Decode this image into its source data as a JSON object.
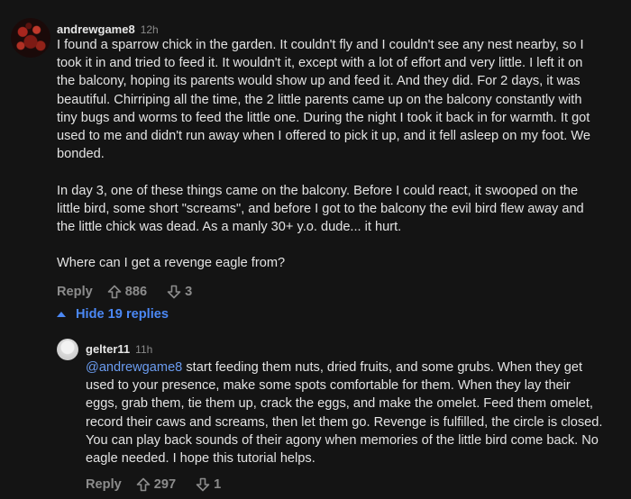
{
  "main_comment": {
    "username": "andrewgame8",
    "timestamp": "12h",
    "paragraphs": [
      "I found a sparrow chick in the garden. It couldn't fly and I couldn't see any nest nearby, so I took it in and tried to feed it. It wouldn't it, except with a lot of effort and very little. I left it on the balcony, hoping its parents would show up and feed it. And they did. For 2 days, it was beautiful. Chirriping all the time, the 2 little parents came up on the balcony constantly with tiny bugs and worms to feed the little one. During the night I took it back in for warmth. It got used to me and didn't run away when I offered to pick it up, and it fell asleep on my foot. We bonded.",
      "In day 3, one of these things came on the balcony. Before I could react, it swooped on the little bird, some short \"screams\", and before I got to the balcony the evil bird flew away and the little chick was dead. As a manly 30+ y.o. dude... it hurt.",
      "Where can I get a revenge eagle from?"
    ],
    "reply_label": "Reply",
    "upvotes": "886",
    "downvotes": "3"
  },
  "hide_replies": {
    "label": "Hide 19 replies",
    "icon": "caret-up-icon"
  },
  "reply_comment": {
    "username": "gelter11",
    "timestamp": "11h",
    "mention": "@andrewgame8",
    "text": " start feeding them nuts, dried fruits, and some grubs. When they get used to your presence, make some spots comfortable for them. When they lay their eggs, grab them, tie them up, crack the eggs, and make the omelet. Feed them omelet, record their caws and screams, then let them go. Revenge is fulfilled, the circle is closed. You can play back sounds of their agony when memories of the little bird come back. No eagle needed. I hope this tutorial helps.",
    "reply_label": "Reply",
    "upvotes": "297",
    "downvotes": "1"
  },
  "colors": {
    "background": "#141414",
    "text": "#e3e3e3",
    "muted": "#8c8c8c",
    "link": "#4b88f5",
    "mention": "#6b9cf0"
  }
}
